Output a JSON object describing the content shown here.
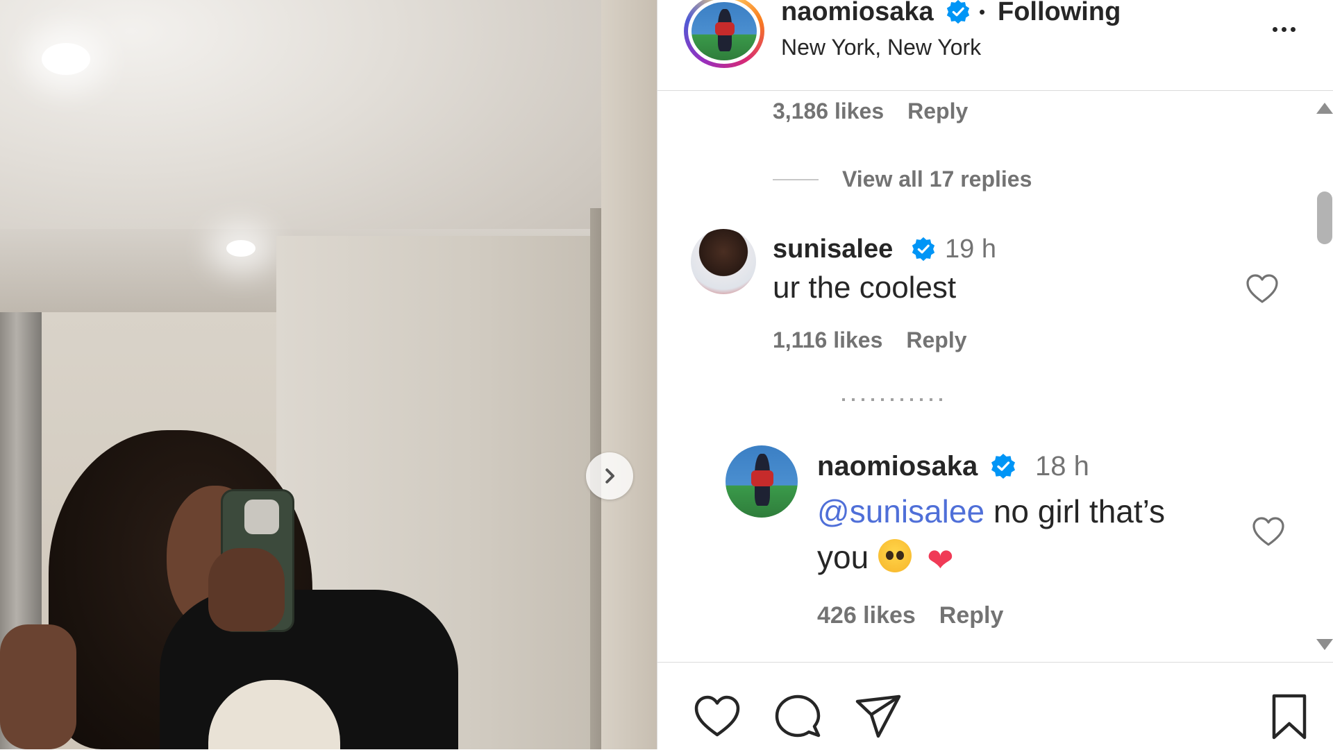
{
  "post": {
    "author": "naomiosaka",
    "separator": "•",
    "follow_status": "Following",
    "location": "New York, New York"
  },
  "comments": {
    "prev_meta": {
      "likes": "3,186 likes",
      "reply": "Reply"
    },
    "view_replies": "View all 17 replies",
    "items": [
      {
        "username": "sunisalee",
        "time": "19 h",
        "text": "ur the coolest",
        "likes": "1,116 likes",
        "reply": "Reply"
      },
      {
        "username": "naomiosaka",
        "time": "18 h",
        "mention": "@sunisalee",
        "text": "no girl that’s",
        "text_line2": "you",
        "emojis": [
          "pleading-face",
          "red-heart"
        ],
        "heart_char": "❤",
        "likes": "426 likes",
        "reply": "Reply"
      }
    ]
  },
  "icons": {
    "verified": "verified-badge-icon",
    "more": "more-options-icon",
    "next": "chevron-right-icon",
    "like": "heart-icon",
    "comment": "comment-bubble-icon",
    "share": "paper-plane-icon",
    "save": "bookmark-icon"
  },
  "colors": {
    "verified": "#0095f6",
    "mention": "#4f6fd8",
    "heart_emoji": "#f03a56",
    "muted": "#737373"
  }
}
